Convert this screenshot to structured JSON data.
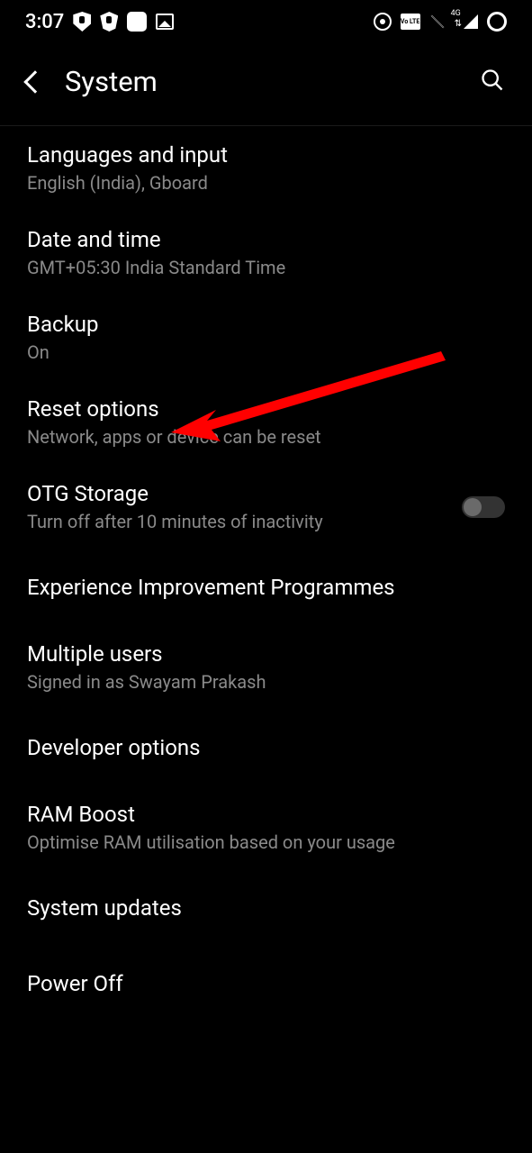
{
  "statusBar": {
    "time": "3:07",
    "volteLabel": "Vo LTE",
    "networkType": "4G"
  },
  "header": {
    "title": "System"
  },
  "settings": [
    {
      "title": "Languages and input",
      "subtitle": "English (India), Gboard",
      "hasToggle": false
    },
    {
      "title": "Date and time",
      "subtitle": "GMT+05:30 India Standard Time",
      "hasToggle": false
    },
    {
      "title": "Backup",
      "subtitle": "On",
      "hasToggle": false
    },
    {
      "title": "Reset options",
      "subtitle": "Network, apps or device can be reset",
      "hasToggle": false
    },
    {
      "title": "OTG Storage",
      "subtitle": "Turn off after 10 minutes of inactivity",
      "hasToggle": true,
      "toggleOn": false
    },
    {
      "title": "Experience Improvement Programmes",
      "subtitle": "",
      "hasToggle": false
    },
    {
      "title": "Multiple users",
      "subtitle": "Signed in as Swayam Prakash",
      "hasToggle": false
    },
    {
      "title": "Developer options",
      "subtitle": "",
      "hasToggle": false
    },
    {
      "title": "RAM Boost",
      "subtitle": "Optimise RAM utilisation based on your usage",
      "hasToggle": false
    },
    {
      "title": "System updates",
      "subtitle": "",
      "hasToggle": false
    },
    {
      "title": "Power Off",
      "subtitle": "",
      "hasToggle": false
    }
  ]
}
